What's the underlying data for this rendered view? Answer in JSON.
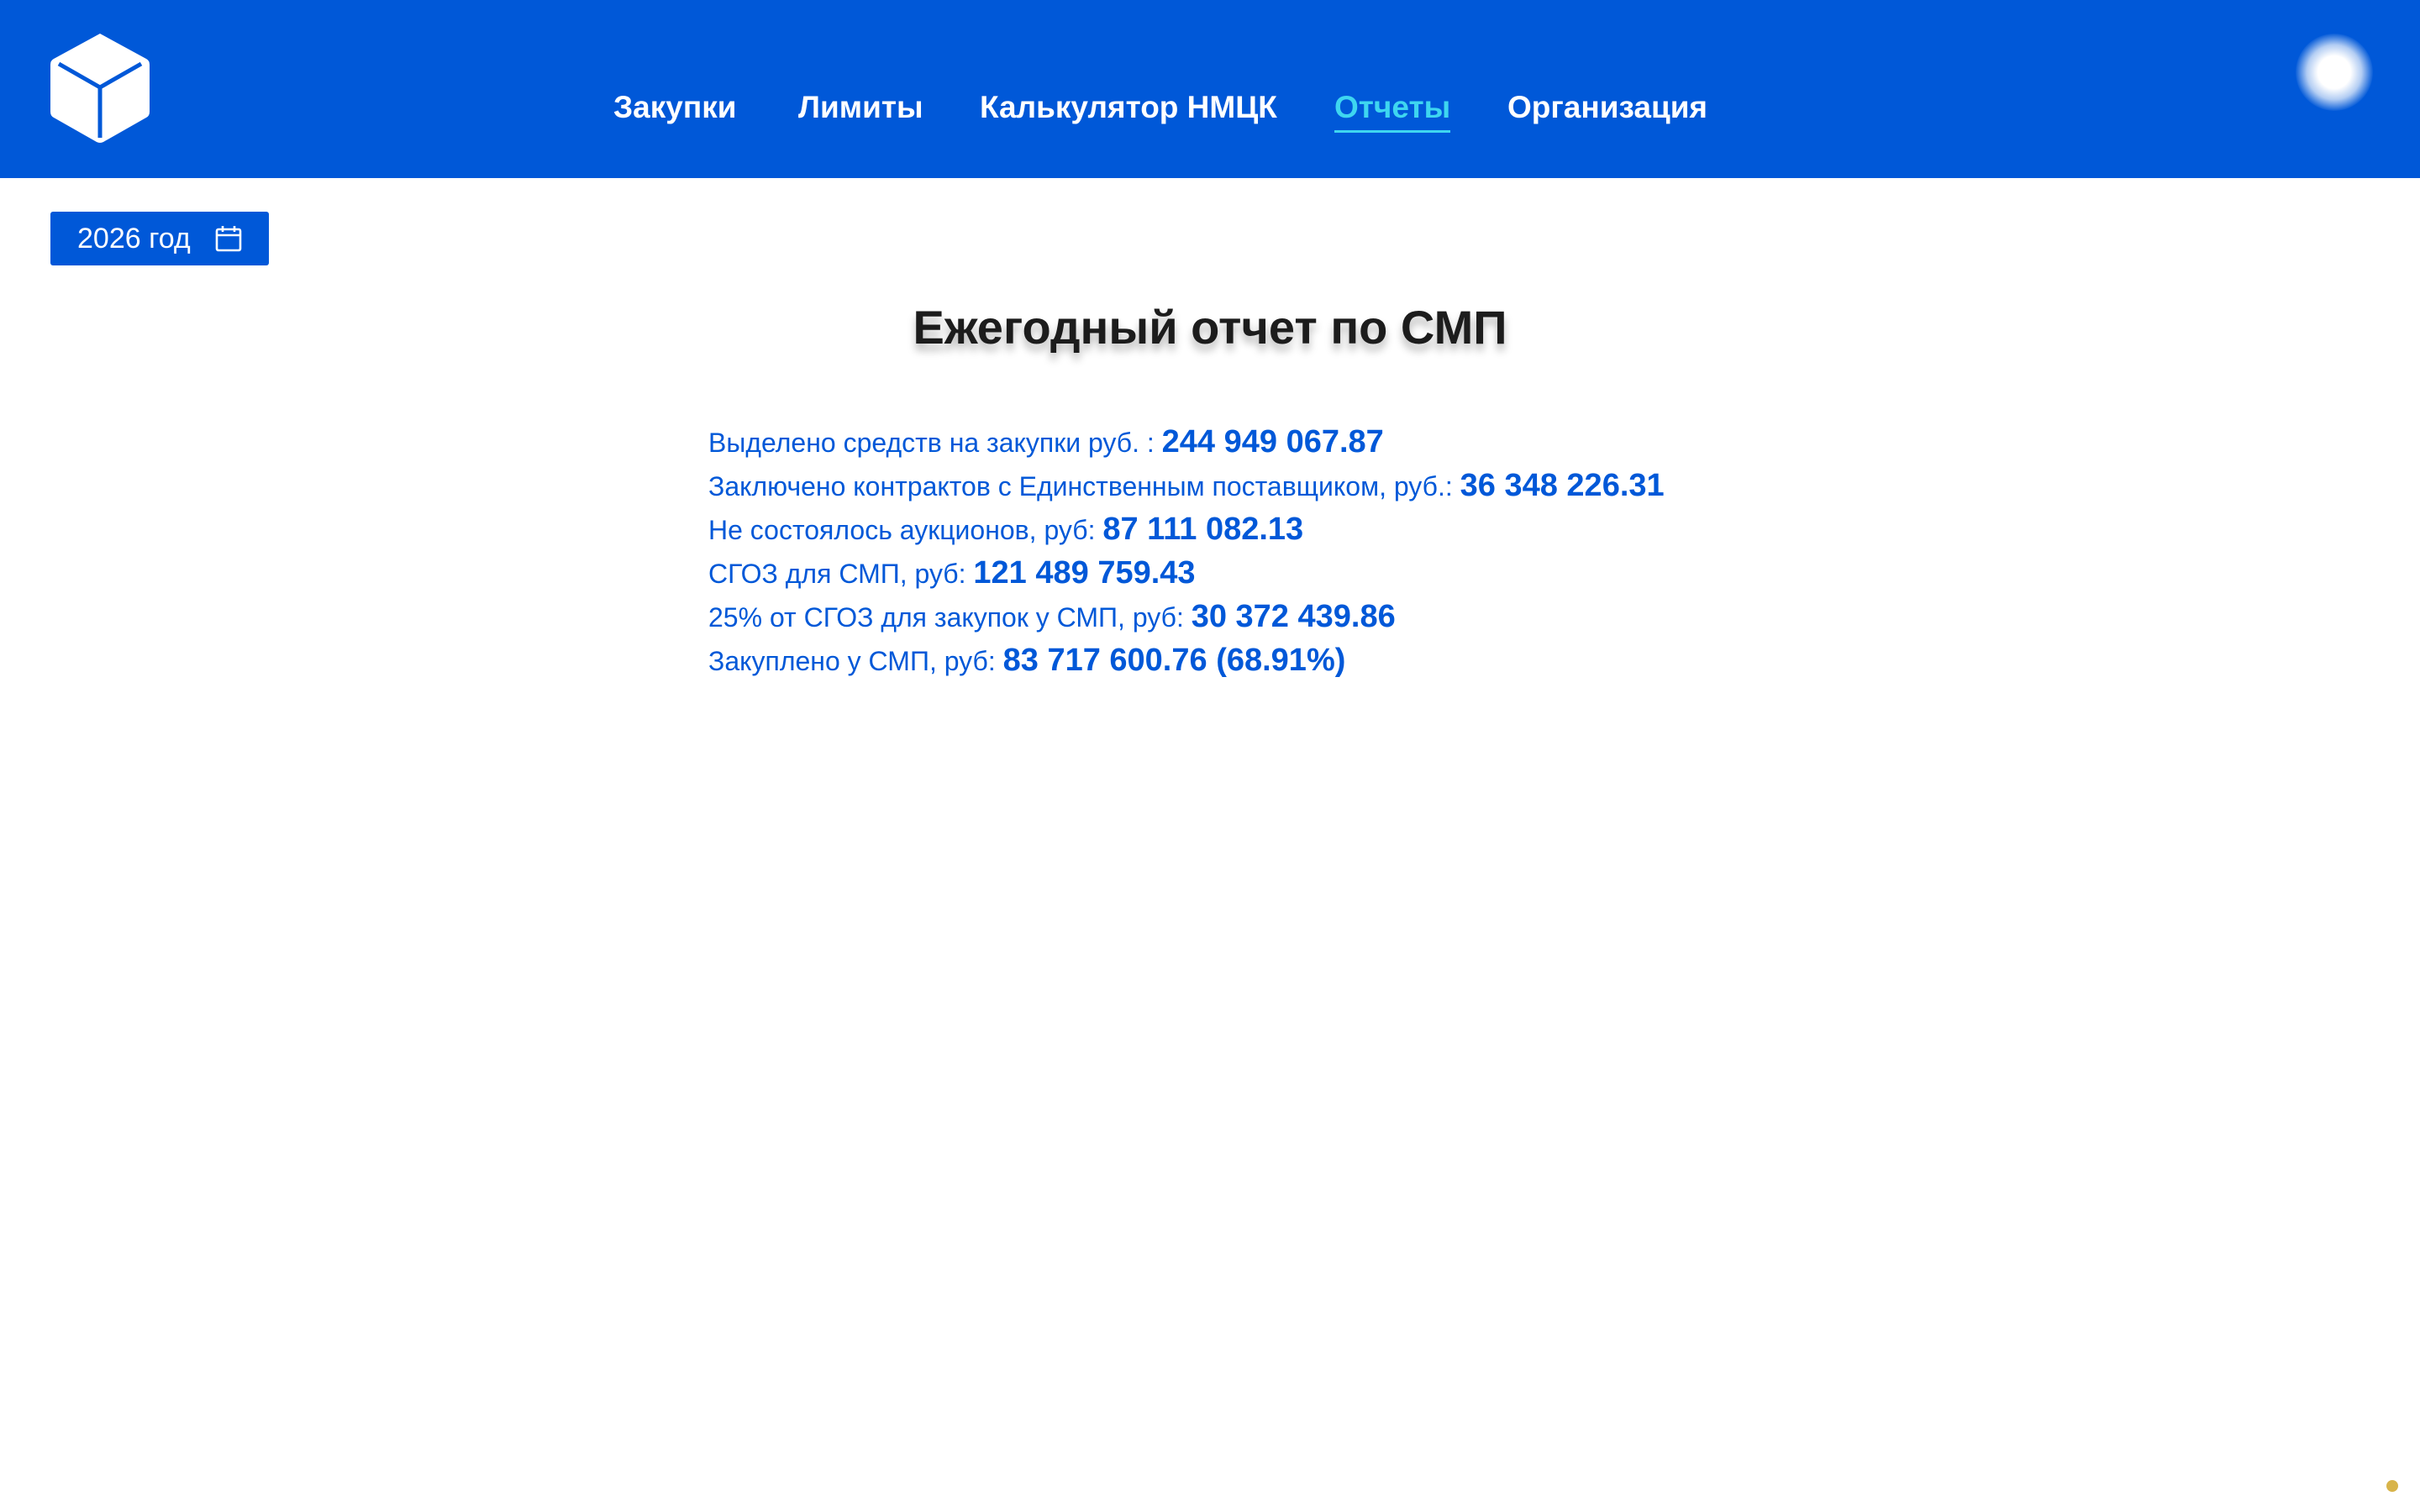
{
  "header": {
    "nav": [
      {
        "label": "Закупки"
      },
      {
        "label": "Лимиты"
      },
      {
        "label": "Калькулятор НМЦК"
      },
      {
        "label": "Отчеты",
        "active": true
      },
      {
        "label": "Организация"
      }
    ],
    "logo_icon": "cube-icon",
    "avatar_icon": "avatar"
  },
  "year_selector": {
    "label": "2026 год",
    "icon": "calendar-icon"
  },
  "report": {
    "title": "Ежегодный отчет по СМП",
    "rows": [
      {
        "label": "Выделено средств на закупки руб. :",
        "value": "244 949 067.87"
      },
      {
        "label": "Заключено контрактов с Единственным поставщиком, руб.:",
        "value": "36 348 226.31"
      },
      {
        "label": "Не состоялось аукционов, руб:",
        "value": "87 111 082.13"
      },
      {
        "label": "СГОЗ для СМП, руб:",
        "value": "121 489 759.43"
      },
      {
        "label": "25% от СГОЗ для закупок у СМП, руб:",
        "value": "30 372 439.86"
      },
      {
        "label": "Закуплено у СМП, руб:",
        "value": "83 717 600.76 (68.91%)"
      }
    ]
  },
  "colors": {
    "brand": "#0058d8",
    "active_nav": "#3ed6f0",
    "title_text": "#1c1c1c"
  }
}
